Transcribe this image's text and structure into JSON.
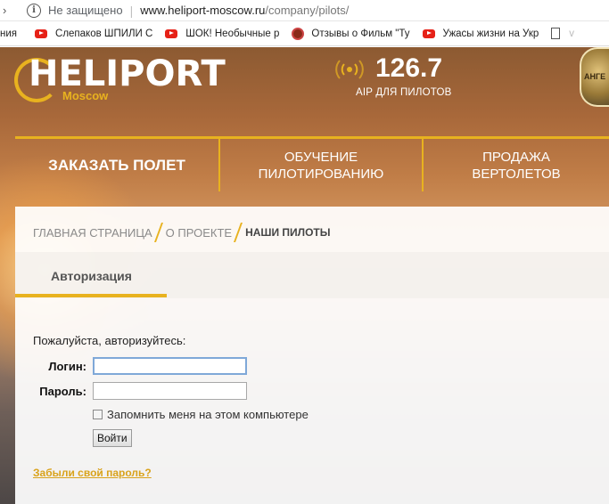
{
  "browser": {
    "security_label": "Не защищено",
    "url_main": "www.heliport-moscow.ru",
    "url_path": "/company/pilots/",
    "bookmarks": [
      {
        "icon": "doc-fragment-icon",
        "label": "ния"
      },
      {
        "icon": "youtube-icon",
        "label": "Слепаков ШПИЛИ С"
      },
      {
        "icon": "youtube-icon",
        "label": "ШОК! Необычные р"
      },
      {
        "icon": "cinema-icon",
        "label": "Отзывы о Фильм \"Ту"
      },
      {
        "icon": "youtube-icon",
        "label": "Ужасы жизни на Укр"
      },
      {
        "icon": "document-icon",
        "label": "v"
      }
    ]
  },
  "site": {
    "logo_text": "HELIPORT",
    "logo_city": "Moscow",
    "radio_frequency": "126.7",
    "radio_label": "AIP ДЛЯ ПИЛОТОВ",
    "badge_text": "АНГЕ",
    "accent_color": "#e8b21f",
    "nav": [
      {
        "label": "ЗАКАЗАТЬ ПОЛЕТ"
      },
      {
        "label_line1": "ОБУЧЕНИЕ",
        "label_line2": "ПИЛОТИРОВАНИЮ"
      },
      {
        "label_line1": "ПРОДАЖА",
        "label_line2": "ВЕРТОЛЕТОВ"
      }
    ],
    "breadcrumbs": [
      "ГЛАВНАЯ СТРАНИЦА",
      "О ПРОЕКТЕ",
      "НАШИ ПИЛОТЫ"
    ]
  },
  "auth": {
    "tab_label": "Авторизация",
    "prompt": "Пожалуйста, авторизуйтесь:",
    "login_label": "Логин:",
    "login_value": "",
    "password_label": "Пароль:",
    "password_value": "",
    "remember_label": "Запомнить меня на этом компьютере",
    "remember_checked": false,
    "submit_label": "Войти",
    "forgot_label": "Забыли свой пароль?"
  }
}
